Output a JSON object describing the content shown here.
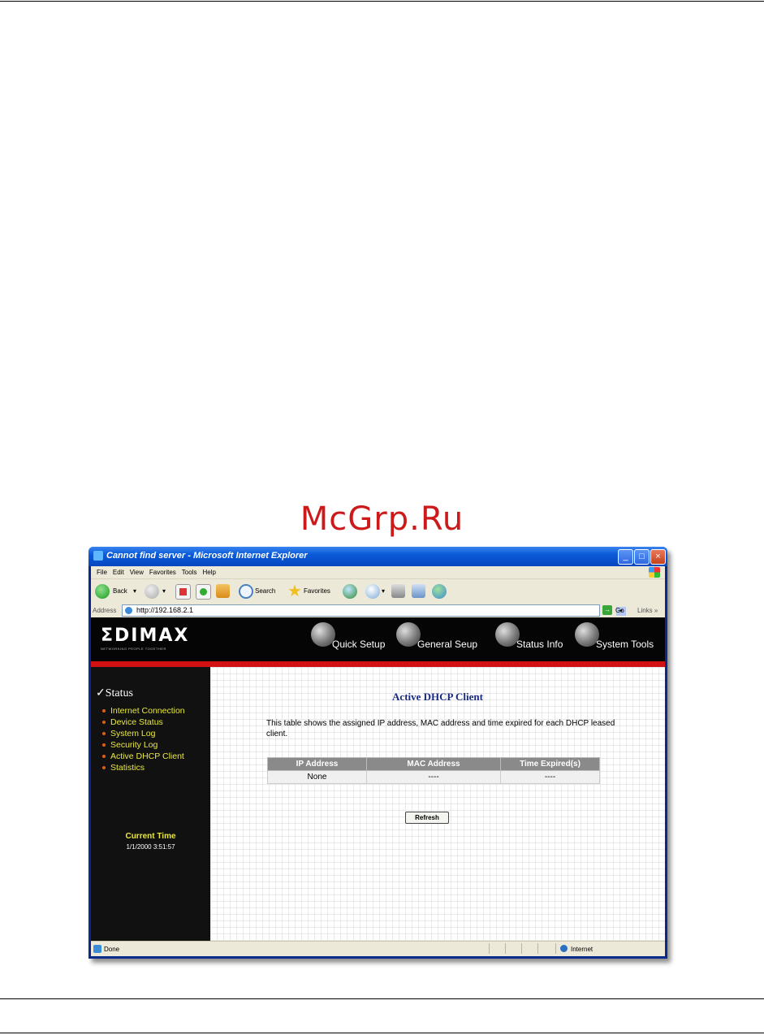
{
  "watermark": "McGrp.Ru",
  "window": {
    "title": "Cannot find server - Microsoft Internet Explorer",
    "minimize": "_",
    "maximize": "□",
    "close": "×"
  },
  "menu": [
    "File",
    "Edit",
    "View",
    "Favorites",
    "Tools",
    "Help"
  ],
  "toolbar": {
    "back_label": "Back",
    "dropdown": "▾",
    "search_label": "Search",
    "favorites_label": "Favorites"
  },
  "address": {
    "label": "Address",
    "url": "http://192.168.2.1",
    "dropdown": "▾",
    "go_icon": "→",
    "go_label": "Go",
    "links_label": "Links »"
  },
  "router": {
    "logo": "ΣDIMAX",
    "tagline": "NETWORKING PEOPLE TOGETHER",
    "nav": [
      "Quick Setup",
      "General Seup",
      "Status Info",
      "System Tools"
    ],
    "sidebar_heading": "✓Status",
    "sidebar_items": [
      "Internet Connection",
      "Device Status",
      "System Log",
      "Security Log",
      "Active DHCP Client",
      "Statistics"
    ],
    "current_time_label": "Current Time",
    "current_time_value": "1/1/2000 3:51:57",
    "page_title": "Active DHCP Client",
    "description": "This table shows the assigned IP address, MAC address and time expired for each DHCP leased client.",
    "table": {
      "headers": [
        "IP Address",
        "MAC Address",
        "Time Expired(s)"
      ],
      "rows": [
        [
          "None",
          "----",
          "----"
        ]
      ]
    },
    "refresh_label": "Refresh"
  },
  "status": {
    "text": "Done",
    "zone": "Internet"
  }
}
